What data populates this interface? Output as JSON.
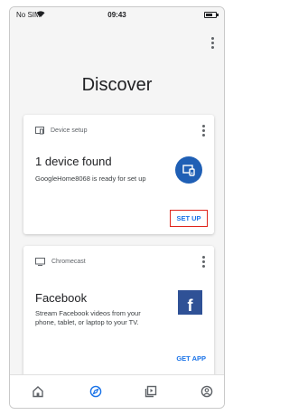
{
  "status_bar": {
    "carrier": "No SIM",
    "time": "09:43"
  },
  "page": {
    "title": "Discover"
  },
  "cards": [
    {
      "header": "Device setup",
      "title": "1 device found",
      "description": "GoogleHome8068 is ready for set up",
      "action": "SET UP"
    },
    {
      "header": "Chromecast",
      "title": "Facebook",
      "description": "Stream Facebook videos from your phone, tablet, or laptop to your TV.",
      "action": "GET APP",
      "logo_letter": "f"
    }
  ],
  "bottom_nav": [
    "home-icon",
    "discover-icon",
    "media-icon",
    "account-icon"
  ],
  "colors": {
    "accent": "#1a73e8",
    "device_circle": "#1f5fb5",
    "facebook": "#2f5196",
    "highlight_border": "#e0241b"
  }
}
